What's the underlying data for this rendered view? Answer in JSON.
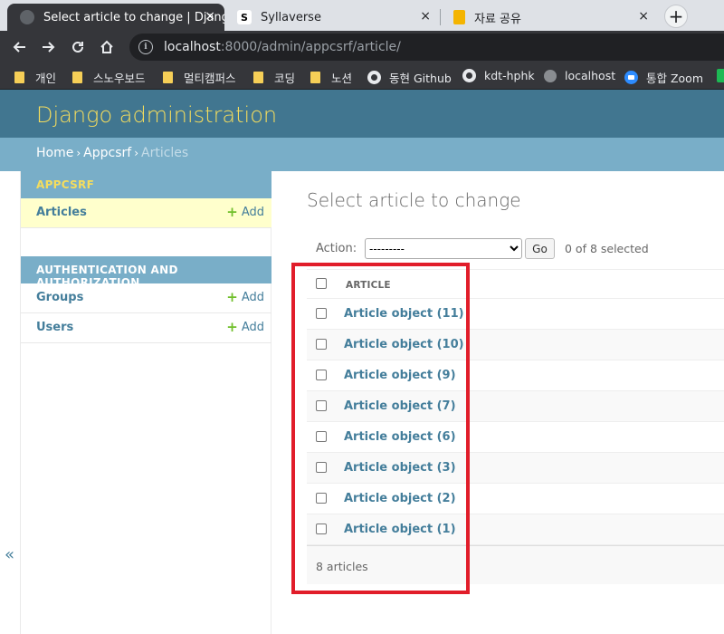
{
  "browser": {
    "tabs": [
      {
        "title": "Select article to change | Django",
        "close": "×",
        "active": true,
        "icon": "globe-icon"
      },
      {
        "title": "Syllaverse",
        "close": "×",
        "active": false,
        "icon": "s-logo-icon",
        "icon_letter": "S"
      },
      {
        "title": "자료 공유",
        "close": "×",
        "active": false,
        "icon": "notebook-icon"
      }
    ],
    "new_tab": "+",
    "url_host": "localhost",
    "url_path": ":8000/admin/appcsrf/article/",
    "bookmarks": [
      {
        "label": "개인",
        "icon": "folder-icon"
      },
      {
        "label": "스노우보드",
        "icon": "folder-icon"
      },
      {
        "label": "멀티캠퍼스",
        "icon": "folder-icon"
      },
      {
        "label": "코딩",
        "icon": "folder-icon"
      },
      {
        "label": "노션",
        "icon": "folder-icon"
      },
      {
        "label": "동현 Github",
        "icon": "github-icon"
      },
      {
        "label": "kdt-hphk",
        "icon": "github-icon"
      },
      {
        "label": "localhost",
        "icon": "globe-icon"
      },
      {
        "label": "통합 Zoom",
        "icon": "zoom-icon"
      }
    ]
  },
  "admin": {
    "brand": "Django administration",
    "breadcrumbs": {
      "home": "Home",
      "app": "Appcsrf",
      "current": "Articles",
      "sep": "›"
    },
    "sidebar": {
      "modules": [
        {
          "caption": "APPCSRF",
          "rows": [
            {
              "name": "Articles",
              "add": "Add",
              "selected": true
            }
          ]
        },
        {
          "caption": "AUTHENTICATION AND AUTHORIZATION",
          "rows": [
            {
              "name": "Groups",
              "add": "Add",
              "selected": false
            },
            {
              "name": "Users",
              "add": "Add",
              "selected": false
            }
          ]
        }
      ],
      "collapse_toggle": "«"
    },
    "page_title": "Select article to change",
    "actions": {
      "label": "Action:",
      "selected_option": "---------",
      "go": "Go",
      "counter": "0 of 8 selected"
    },
    "table": {
      "column": "ARTICLE",
      "rows": [
        "Article object (11)",
        "Article object (10)",
        "Article object (9)",
        "Article object (7)",
        "Article object (6)",
        "Article object (3)",
        "Article object (2)",
        "Article object (1)"
      ]
    },
    "paginator": "8 articles",
    "colors": {
      "header": "#417690",
      "breadcrumbs": "#79aec8",
      "brand": "#f5dd5d",
      "link": "#447e9b",
      "add_plus": "#70bf2b",
      "selected_row": "#ffffcc",
      "annotation_box": "#e11d2a"
    }
  }
}
